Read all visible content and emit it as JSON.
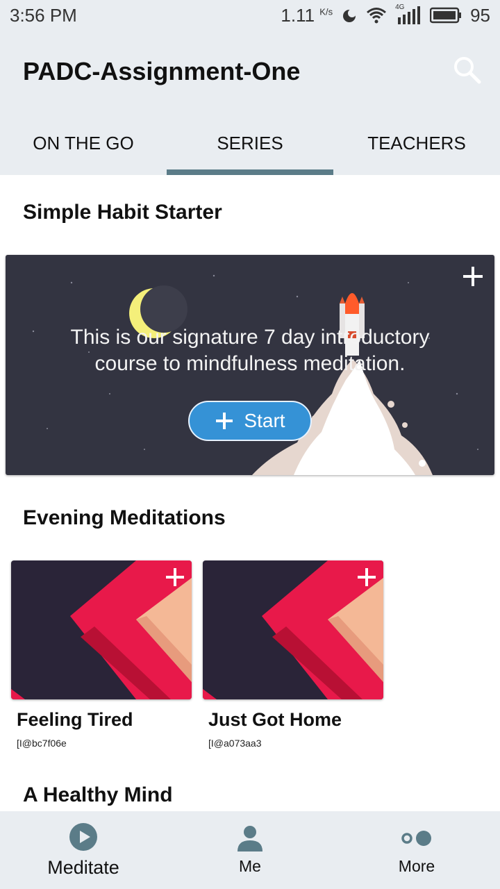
{
  "status_bar": {
    "time": "3:56 PM",
    "speed": "1.11",
    "speed_unit": "K/s",
    "network": "4G",
    "battery": "95"
  },
  "app_bar": {
    "title": "PADC-Assignment-One",
    "search_icon": "search-icon"
  },
  "tabs": [
    {
      "label": "ON THE GO",
      "active": false
    },
    {
      "label": "SERIES",
      "active": true
    },
    {
      "label": "TEACHERS",
      "active": false
    }
  ],
  "sections": {
    "starter": {
      "title": "Simple Habit Starter",
      "description": "This is our signature 7 day introductory course to mindfulness meditation.",
      "start_label": "Start"
    },
    "evening": {
      "title": "Evening Meditations",
      "cards": [
        {
          "title": "Feeling Tired",
          "subtitle": "[I@bc7f06e"
        },
        {
          "title": "Just Got Home",
          "subtitle": "[I@a073aa3"
        }
      ]
    },
    "healthy": {
      "title": "A Healthy Mind"
    }
  },
  "bottom_nav": [
    {
      "label": "Meditate",
      "icon": "play-icon",
      "active": true
    },
    {
      "label": "Me",
      "icon": "person-icon",
      "active": false
    },
    {
      "label": "More",
      "icon": "more-icon",
      "active": false
    }
  ],
  "colors": {
    "bar_background": "#e9edf1",
    "tab_indicator": "#5b7c88",
    "start_button": "#3592d6",
    "hero_background": "#333441",
    "card_red": "#e8194a",
    "card_peach": "#f4b896"
  }
}
